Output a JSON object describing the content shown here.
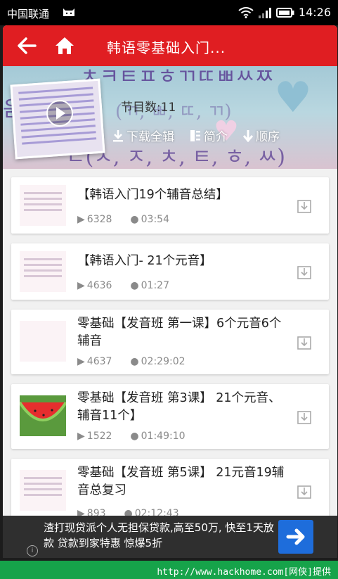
{
  "status_bar": {
    "carrier": "中国联通",
    "time": "14:26"
  },
  "topbar": {
    "title": "韩语零基础入门..."
  },
  "banner": {
    "count_label": "节目数:11",
    "actions": [
      {
        "label": "下载全辑",
        "icon": "download-icon"
      },
      {
        "label": "简介",
        "icon": "list-icon"
      },
      {
        "label": "顺序",
        "icon": "arrow-down-icon"
      }
    ]
  },
  "items": [
    {
      "title": "【韩语入门19个辅音总结】",
      "plays": "6328",
      "duration": "03:54",
      "thumb": "letters"
    },
    {
      "title": "【韩语入门- 21个元音】",
      "plays": "4636",
      "duration": "01:27",
      "thumb": "letters"
    },
    {
      "title": "零基础【发音班 第一课】6个元音6个辅音",
      "plays": "4637",
      "duration": "02:29:02",
      "thumb": "flower"
    },
    {
      "title": "零基础【发音班 第3课】 21个元音、辅音11个】",
      "plays": "1522",
      "duration": "01:49:10",
      "thumb": "watermelon"
    },
    {
      "title": "零基础【发音班 第5课】 21元音19辅音总复习",
      "plays": "893",
      "duration": "02:12:43",
      "thumb": "letters"
    }
  ],
  "ad": {
    "text": "渣打现贷派个人无担保贷款,高至50万, 快至1天放款 贷款到家特惠 惊爆5折"
  },
  "footer": {
    "watermark": "http://www.hackhome.com[网侠]提供"
  }
}
